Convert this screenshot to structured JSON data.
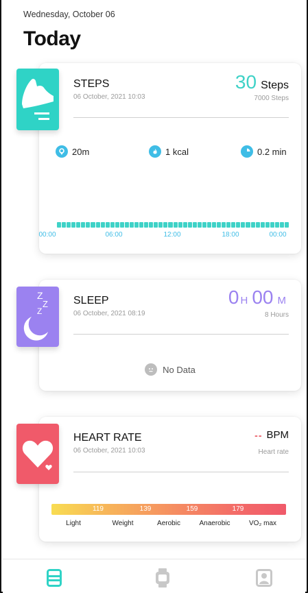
{
  "header": {
    "date": "Wednesday, October 06",
    "title": "Today"
  },
  "steps": {
    "title": "STEPS",
    "timestamp": "06 October, 2021 10:03",
    "value": "30",
    "unit": "Steps",
    "goal": "7000 Steps",
    "distance": "20m",
    "calories": "1 kcal",
    "duration": "0.2 min",
    "axis": [
      "00:00",
      "06:00",
      "12:00",
      "18:00",
      "00:00"
    ],
    "accent": "#3fd2c7"
  },
  "sleep": {
    "title": "SLEEP",
    "timestamp": "06 October, 2021 08:19",
    "hours": "0",
    "hours_unit": "H",
    "minutes": "00",
    "minutes_unit": "M",
    "goal": "8 Hours",
    "no_data": "No Data",
    "accent": "#9b82f0"
  },
  "heart": {
    "title": "HEART RATE",
    "timestamp": "06 October, 2021 10:03",
    "value": "--",
    "unit": "BPM",
    "sub": "Heart rate",
    "zones": [
      "119",
      "139",
      "159",
      "179"
    ],
    "labels": [
      "Light",
      "Weight",
      "Aerobic",
      "Anaerobic",
      "VO₂ max"
    ],
    "accent": "#f05a6a"
  },
  "tabs": [
    {
      "name": "today",
      "icon": "list-card-icon",
      "active": true
    },
    {
      "name": "device",
      "icon": "watch-icon",
      "active": false
    },
    {
      "name": "profile",
      "icon": "person-icon",
      "active": false
    }
  ]
}
